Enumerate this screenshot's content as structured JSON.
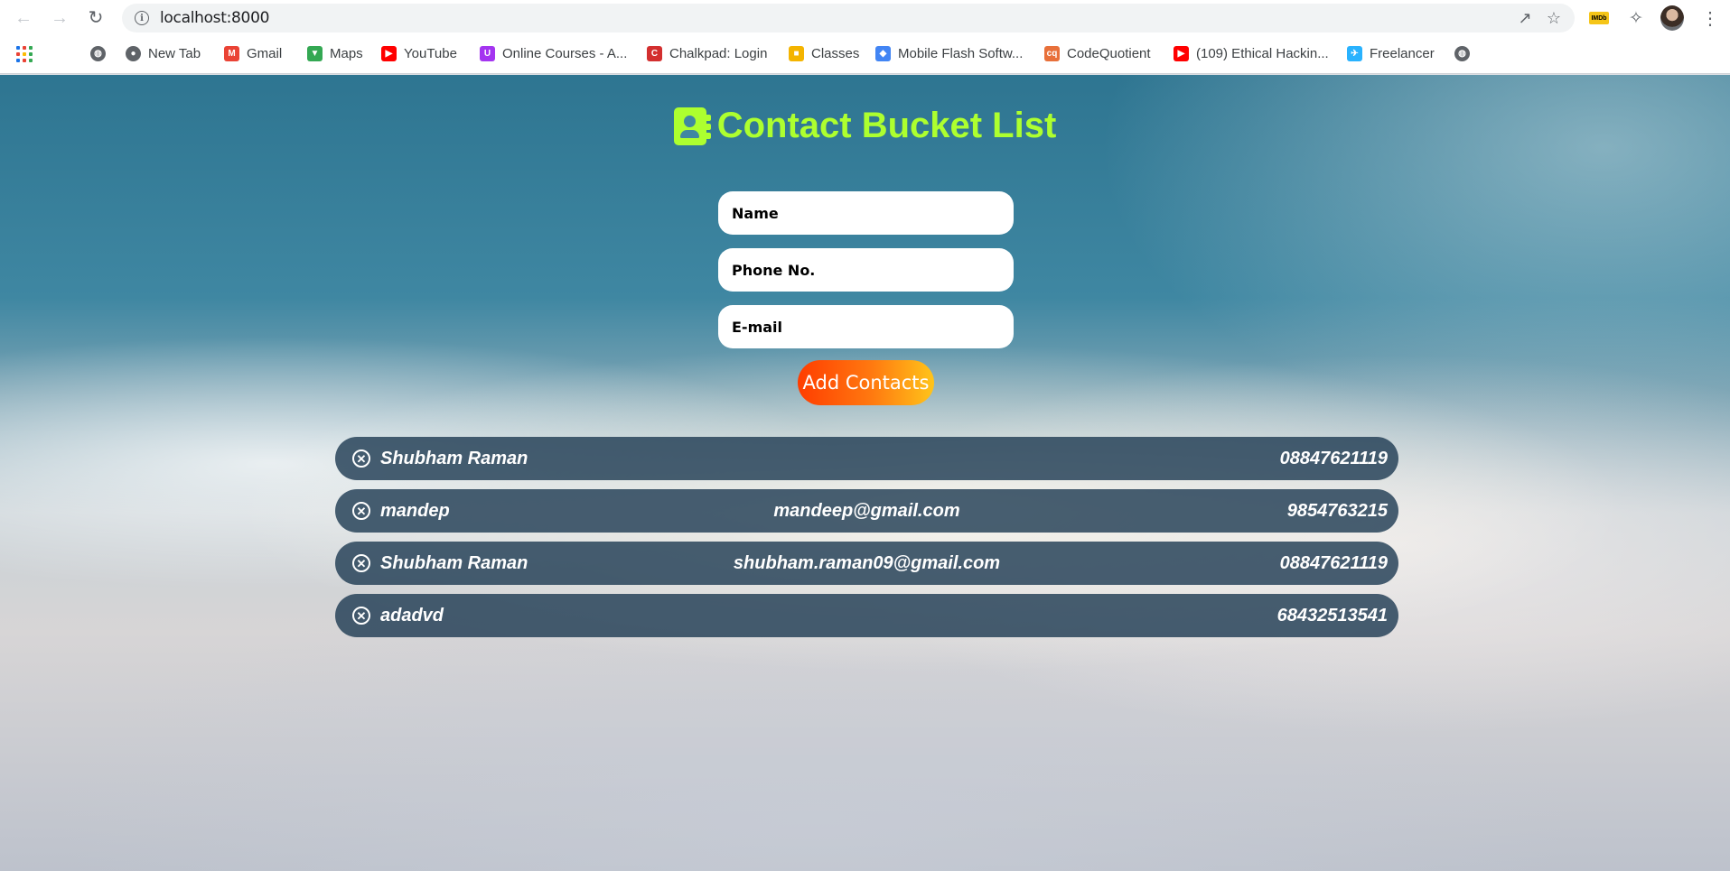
{
  "browser": {
    "url": "localhost:8000",
    "bookmarks": [
      {
        "label": "",
        "icon": "globe-icon",
        "color": "#5f6368"
      },
      {
        "label": "New Tab",
        "icon": "new-tab-icon",
        "color": "#5f6368"
      },
      {
        "label": "Gmail",
        "icon": "gmail-icon",
        "color": "#ea4335"
      },
      {
        "label": "Maps",
        "icon": "maps-icon",
        "color": "#34a853"
      },
      {
        "label": "YouTube",
        "icon": "youtube-icon",
        "color": "#ff0000"
      },
      {
        "label": "Online Courses - A...",
        "icon": "courses-icon",
        "color": "#a435f0"
      },
      {
        "label": "Chalkpad: Login",
        "icon": "chalkpad-icon",
        "color": "#d32f2f"
      },
      {
        "label": "Classes",
        "icon": "classes-icon",
        "color": "#f4b400"
      },
      {
        "label": "Mobile Flash Softw...",
        "icon": "flash-software-icon",
        "color": "#4285f4"
      },
      {
        "label": "CodeQuotient",
        "icon": "codequotient-icon",
        "color": "#e8703a"
      },
      {
        "label": "(109) Ethical Hackin...",
        "icon": "youtube-icon",
        "color": "#ff0000"
      },
      {
        "label": "Freelancer",
        "icon": "freelancer-icon",
        "color": "#29b2fe"
      },
      {
        "label": "",
        "icon": "globe-icon",
        "color": "#5f6368"
      }
    ]
  },
  "app": {
    "title": "Contact Bucket List",
    "title_color": "#adff2f",
    "form": {
      "name_placeholder": "Name",
      "phone_placeholder": "Phone No.",
      "email_placeholder": "E-mail",
      "submit_label": "Add Contacts"
    },
    "contacts": [
      {
        "name": "Shubham Raman",
        "email": "",
        "phone": "08847621119"
      },
      {
        "name": "mandep",
        "email": "mandeep@gmail.com",
        "phone": "9854763215"
      },
      {
        "name": "Shubham Raman",
        "email": "shubham.raman09@gmail.com",
        "phone": "08847621119"
      },
      {
        "name": "adadvd",
        "email": "",
        "phone": "68432513541"
      }
    ]
  }
}
